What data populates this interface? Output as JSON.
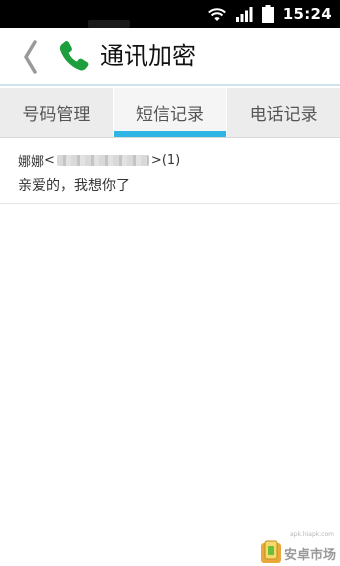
{
  "status_bar": {
    "time": "15:24"
  },
  "title_bar": {
    "title": "通讯加密"
  },
  "tabs": [
    {
      "label": "号码管理",
      "active": false
    },
    {
      "label": "短信记录",
      "active": true
    },
    {
      "label": "电话记录",
      "active": false
    }
  ],
  "messages": [
    {
      "sender_name": "娜娜",
      "open": "<",
      "close": ">",
      "count": "(1)",
      "body": "亲爱的，我想你了"
    }
  ],
  "watermark": {
    "url": "apk.hiapk.com",
    "text": "安卓市场"
  },
  "colors": {
    "accent": "#2fb4e6",
    "phone_icon": "#1e9e3e",
    "tab_bg": "#ececec"
  }
}
